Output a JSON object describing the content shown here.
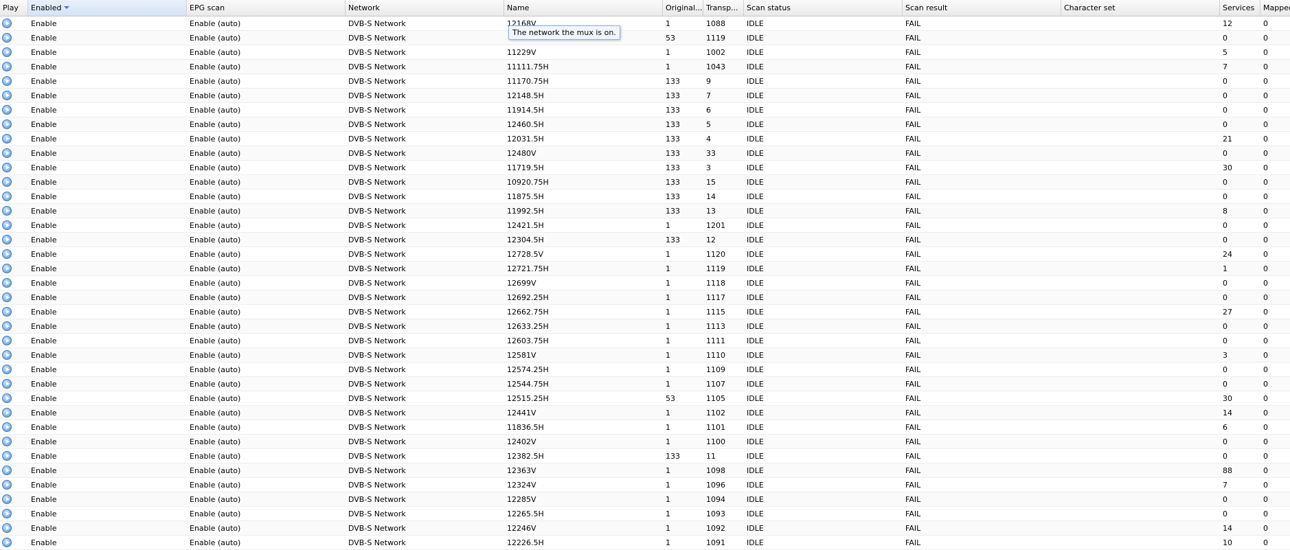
{
  "columns": [
    "Play",
    "Enabled",
    "EPG scan",
    "Network",
    "Name",
    "Original...",
    "Transp...",
    "Scan status",
    "Scan result",
    "Character set",
    "Services",
    "Mapped"
  ],
  "tooltip": "The network the mux is on.",
  "rows": [
    {
      "enabled": "Enable",
      "epg": "Enable (auto)",
      "network": "DVB-S Network",
      "name": "12168V",
      "onid": "1",
      "tsid": "1088",
      "status": "IDLE",
      "result": "FAIL",
      "charset": "",
      "services": "12",
      "mapped": "0"
    },
    {
      "enabled": "Enable",
      "epg": "Enable (auto)",
      "network": "DVB-S Network",
      "name": "",
      "onid": "53",
      "tsid": "1119",
      "status": "IDLE",
      "result": "FAIL",
      "charset": "",
      "services": "0",
      "mapped": "0"
    },
    {
      "enabled": "Enable",
      "epg": "Enable (auto)",
      "network": "DVB-S Network",
      "name": "11229V",
      "onid": "1",
      "tsid": "1002",
      "status": "IDLE",
      "result": "FAIL",
      "charset": "",
      "services": "5",
      "mapped": "0"
    },
    {
      "enabled": "Enable",
      "epg": "Enable (auto)",
      "network": "DVB-S Network",
      "name": "11111.75H",
      "onid": "1",
      "tsid": "1043",
      "status": "IDLE",
      "result": "FAIL",
      "charset": "",
      "services": "7",
      "mapped": "0"
    },
    {
      "enabled": "Enable",
      "epg": "Enable (auto)",
      "network": "DVB-S Network",
      "name": "11170.75H",
      "onid": "133",
      "tsid": "9",
      "status": "IDLE",
      "result": "FAIL",
      "charset": "",
      "services": "0",
      "mapped": "0"
    },
    {
      "enabled": "Enable",
      "epg": "Enable (auto)",
      "network": "DVB-S Network",
      "name": "12148.5H",
      "onid": "133",
      "tsid": "7",
      "status": "IDLE",
      "result": "FAIL",
      "charset": "",
      "services": "0",
      "mapped": "0"
    },
    {
      "enabled": "Enable",
      "epg": "Enable (auto)",
      "network": "DVB-S Network",
      "name": "11914.5H",
      "onid": "133",
      "tsid": "6",
      "status": "IDLE",
      "result": "FAIL",
      "charset": "",
      "services": "0",
      "mapped": "0"
    },
    {
      "enabled": "Enable",
      "epg": "Enable (auto)",
      "network": "DVB-S Network",
      "name": "12460.5H",
      "onid": "133",
      "tsid": "5",
      "status": "IDLE",
      "result": "FAIL",
      "charset": "",
      "services": "0",
      "mapped": "0"
    },
    {
      "enabled": "Enable",
      "epg": "Enable (auto)",
      "network": "DVB-S Network",
      "name": "12031.5H",
      "onid": "133",
      "tsid": "4",
      "status": "IDLE",
      "result": "FAIL",
      "charset": "",
      "services": "21",
      "mapped": "0"
    },
    {
      "enabled": "Enable",
      "epg": "Enable (auto)",
      "network": "DVB-S Network",
      "name": "12480V",
      "onid": "133",
      "tsid": "33",
      "status": "IDLE",
      "result": "FAIL",
      "charset": "",
      "services": "0",
      "mapped": "0"
    },
    {
      "enabled": "Enable",
      "epg": "Enable (auto)",
      "network": "DVB-S Network",
      "name": "11719.5H",
      "onid": "133",
      "tsid": "3",
      "status": "IDLE",
      "result": "FAIL",
      "charset": "",
      "services": "30",
      "mapped": "0"
    },
    {
      "enabled": "Enable",
      "epg": "Enable (auto)",
      "network": "DVB-S Network",
      "name": "10920.75H",
      "onid": "133",
      "tsid": "15",
      "status": "IDLE",
      "result": "FAIL",
      "charset": "",
      "services": "0",
      "mapped": "0"
    },
    {
      "enabled": "Enable",
      "epg": "Enable (auto)",
      "network": "DVB-S Network",
      "name": "11875.5H",
      "onid": "133",
      "tsid": "14",
      "status": "IDLE",
      "result": "FAIL",
      "charset": "",
      "services": "0",
      "mapped": "0"
    },
    {
      "enabled": "Enable",
      "epg": "Enable (auto)",
      "network": "DVB-S Network",
      "name": "11992.5H",
      "onid": "133",
      "tsid": "13",
      "status": "IDLE",
      "result": "FAIL",
      "charset": "",
      "services": "8",
      "mapped": "0"
    },
    {
      "enabled": "Enable",
      "epg": "Enable (auto)",
      "network": "DVB-S Network",
      "name": "12421.5H",
      "onid": "1",
      "tsid": "1201",
      "status": "IDLE",
      "result": "FAIL",
      "charset": "",
      "services": "0",
      "mapped": "0"
    },
    {
      "enabled": "Enable",
      "epg": "Enable (auto)",
      "network": "DVB-S Network",
      "name": "12304.5H",
      "onid": "133",
      "tsid": "12",
      "status": "IDLE",
      "result": "FAIL",
      "charset": "",
      "services": "0",
      "mapped": "0"
    },
    {
      "enabled": "Enable",
      "epg": "Enable (auto)",
      "network": "DVB-S Network",
      "name": "12728.5V",
      "onid": "1",
      "tsid": "1120",
      "status": "IDLE",
      "result": "FAIL",
      "charset": "",
      "services": "24",
      "mapped": "0"
    },
    {
      "enabled": "Enable",
      "epg": "Enable (auto)",
      "network": "DVB-S Network",
      "name": "12721.75H",
      "onid": "1",
      "tsid": "1119",
      "status": "IDLE",
      "result": "FAIL",
      "charset": "",
      "services": "1",
      "mapped": "0"
    },
    {
      "enabled": "Enable",
      "epg": "Enable (auto)",
      "network": "DVB-S Network",
      "name": "12699V",
      "onid": "1",
      "tsid": "1118",
      "status": "IDLE",
      "result": "FAIL",
      "charset": "",
      "services": "0",
      "mapped": "0"
    },
    {
      "enabled": "Enable",
      "epg": "Enable (auto)",
      "network": "DVB-S Network",
      "name": "12692.25H",
      "onid": "1",
      "tsid": "1117",
      "status": "IDLE",
      "result": "FAIL",
      "charset": "",
      "services": "0",
      "mapped": "0"
    },
    {
      "enabled": "Enable",
      "epg": "Enable (auto)",
      "network": "DVB-S Network",
      "name": "12662.75H",
      "onid": "1",
      "tsid": "1115",
      "status": "IDLE",
      "result": "FAIL",
      "charset": "",
      "services": "27",
      "mapped": "0"
    },
    {
      "enabled": "Enable",
      "epg": "Enable (auto)",
      "network": "DVB-S Network",
      "name": "12633.25H",
      "onid": "1",
      "tsid": "1113",
      "status": "IDLE",
      "result": "FAIL",
      "charset": "",
      "services": "0",
      "mapped": "0"
    },
    {
      "enabled": "Enable",
      "epg": "Enable (auto)",
      "network": "DVB-S Network",
      "name": "12603.75H",
      "onid": "1",
      "tsid": "1111",
      "status": "IDLE",
      "result": "FAIL",
      "charset": "",
      "services": "0",
      "mapped": "0"
    },
    {
      "enabled": "Enable",
      "epg": "Enable (auto)",
      "network": "DVB-S Network",
      "name": "12581V",
      "onid": "1",
      "tsid": "1110",
      "status": "IDLE",
      "result": "FAIL",
      "charset": "",
      "services": "3",
      "mapped": "0"
    },
    {
      "enabled": "Enable",
      "epg": "Enable (auto)",
      "network": "DVB-S Network",
      "name": "12574.25H",
      "onid": "1",
      "tsid": "1109",
      "status": "IDLE",
      "result": "FAIL",
      "charset": "",
      "services": "0",
      "mapped": "0"
    },
    {
      "enabled": "Enable",
      "epg": "Enable (auto)",
      "network": "DVB-S Network",
      "name": "12544.75H",
      "onid": "1",
      "tsid": "1107",
      "status": "IDLE",
      "result": "FAIL",
      "charset": "",
      "services": "0",
      "mapped": "0"
    },
    {
      "enabled": "Enable",
      "epg": "Enable (auto)",
      "network": "DVB-S Network",
      "name": "12515.25H",
      "onid": "53",
      "tsid": "1105",
      "status": "IDLE",
      "result": "FAIL",
      "charset": "",
      "services": "30",
      "mapped": "0"
    },
    {
      "enabled": "Enable",
      "epg": "Enable (auto)",
      "network": "DVB-S Network",
      "name": "12441V",
      "onid": "1",
      "tsid": "1102",
      "status": "IDLE",
      "result": "FAIL",
      "charset": "",
      "services": "14",
      "mapped": "0"
    },
    {
      "enabled": "Enable",
      "epg": "Enable (auto)",
      "network": "DVB-S Network",
      "name": "11836.5H",
      "onid": "1",
      "tsid": "1101",
      "status": "IDLE",
      "result": "FAIL",
      "charset": "",
      "services": "6",
      "mapped": "0"
    },
    {
      "enabled": "Enable",
      "epg": "Enable (auto)",
      "network": "DVB-S Network",
      "name": "12402V",
      "onid": "1",
      "tsid": "1100",
      "status": "IDLE",
      "result": "FAIL",
      "charset": "",
      "services": "0",
      "mapped": "0"
    },
    {
      "enabled": "Enable",
      "epg": "Enable (auto)",
      "network": "DVB-S Network",
      "name": "12382.5H",
      "onid": "133",
      "tsid": "11",
      "status": "IDLE",
      "result": "FAIL",
      "charset": "",
      "services": "0",
      "mapped": "0"
    },
    {
      "enabled": "Enable",
      "epg": "Enable (auto)",
      "network": "DVB-S Network",
      "name": "12363V",
      "onid": "1",
      "tsid": "1098",
      "status": "IDLE",
      "result": "FAIL",
      "charset": "",
      "services": "88",
      "mapped": "0"
    },
    {
      "enabled": "Enable",
      "epg": "Enable (auto)",
      "network": "DVB-S Network",
      "name": "12324V",
      "onid": "1",
      "tsid": "1096",
      "status": "IDLE",
      "result": "FAIL",
      "charset": "",
      "services": "7",
      "mapped": "0"
    },
    {
      "enabled": "Enable",
      "epg": "Enable (auto)",
      "network": "DVB-S Network",
      "name": "12285V",
      "onid": "1",
      "tsid": "1094",
      "status": "IDLE",
      "result": "FAIL",
      "charset": "",
      "services": "0",
      "mapped": "0"
    },
    {
      "enabled": "Enable",
      "epg": "Enable (auto)",
      "network": "DVB-S Network",
      "name": "12265.5H",
      "onid": "1",
      "tsid": "1093",
      "status": "IDLE",
      "result": "FAIL",
      "charset": "",
      "services": "0",
      "mapped": "0"
    },
    {
      "enabled": "Enable",
      "epg": "Enable (auto)",
      "network": "DVB-S Network",
      "name": "12246V",
      "onid": "1",
      "tsid": "1092",
      "status": "IDLE",
      "result": "FAIL",
      "charset": "",
      "services": "14",
      "mapped": "0"
    },
    {
      "enabled": "Enable",
      "epg": "Enable (auto)",
      "network": "DVB-S Network",
      "name": "12226.5H",
      "onid": "1",
      "tsid": "1091",
      "status": "IDLE",
      "result": "FAIL",
      "charset": "",
      "services": "10",
      "mapped": "0"
    }
  ]
}
